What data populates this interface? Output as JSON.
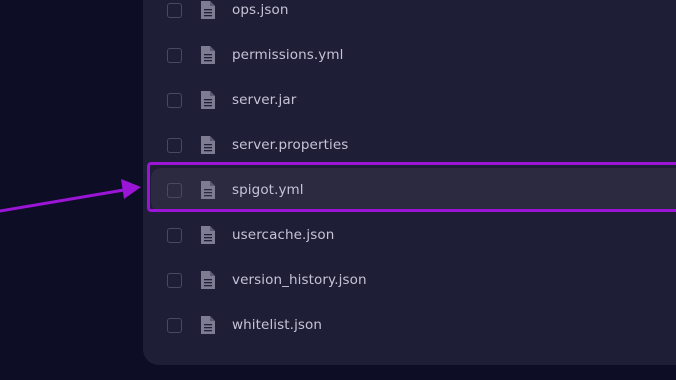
{
  "files": [
    {
      "name": "ops.json"
    },
    {
      "name": "permissions.yml"
    },
    {
      "name": "server.jar"
    },
    {
      "name": "server.properties"
    },
    {
      "name": "spigot.yml",
      "highlighted": true
    },
    {
      "name": "usercache.json"
    },
    {
      "name": "version_history.json"
    },
    {
      "name": "whitelist.json"
    }
  ],
  "icons": {
    "file": "file-document-icon",
    "pointer": "arrow-pointer"
  },
  "colors": {
    "background": "#0e0d26",
    "panel": "#1f1e37",
    "row_highlight": "#2b2a41",
    "accent": "#9a15d6",
    "text": "#c5c4d6",
    "icon": "#7e7c93"
  }
}
